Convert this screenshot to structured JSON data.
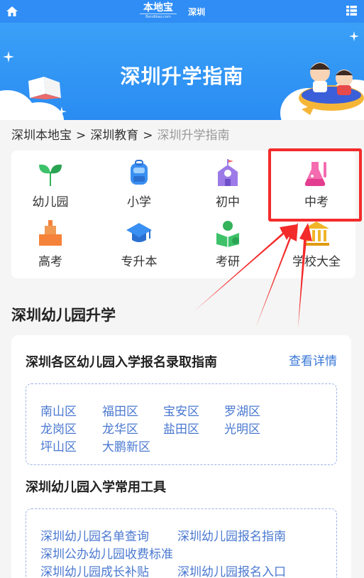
{
  "header": {
    "logo_cn": "本地宝",
    "logo_en": "Bendibao.com",
    "city": "深圳"
  },
  "banner": {
    "title": "深圳升学指南"
  },
  "breadcrumb": {
    "items": [
      "深圳本地宝",
      "深圳教育"
    ],
    "separator": ">",
    "current": "深圳升学指南"
  },
  "categories": [
    {
      "label": "幼儿园",
      "icon": "sprout-icon"
    },
    {
      "label": "小学",
      "icon": "backpack-icon"
    },
    {
      "label": "初中",
      "icon": "school-building-icon"
    },
    {
      "label": "中考",
      "icon": "flask-icon"
    },
    {
      "label": "高考",
      "icon": "podium-icon"
    },
    {
      "label": "专升本",
      "icon": "graduation-cap-icon"
    },
    {
      "label": "考研",
      "icon": "reading-person-icon"
    },
    {
      "label": "学校大全",
      "icon": "institution-icon"
    }
  ],
  "section": {
    "title": "深圳幼儿园升学"
  },
  "enroll": {
    "title": "深圳各区幼儿园入学报名录取指南",
    "detail_link": "查看详情",
    "districts": [
      "南山区",
      "福田区",
      "宝安区",
      "罗湖区",
      "龙岗区",
      "龙华区",
      "盐田区",
      "光明区",
      "坪山区",
      "大鹏新区"
    ]
  },
  "tools": {
    "title": "深圳幼儿园入学常用工具",
    "links": [
      "深圳幼儿园名单查询",
      "深圳幼儿园报名指南",
      "深圳公办幼儿园收费标准",
      "深圳幼儿园成长补贴",
      "深圳幼儿园报名入口"
    ]
  },
  "colors": {
    "header_bg": "#2f8df5",
    "link": "#4a78d0",
    "highlight": "#f42b2b"
  }
}
